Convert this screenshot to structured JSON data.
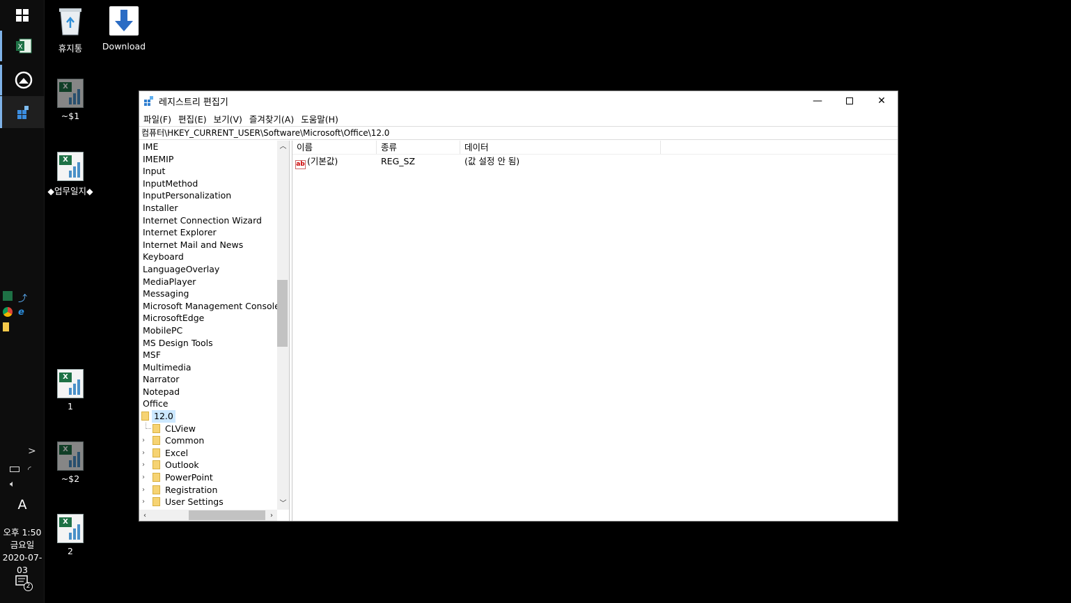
{
  "desktop": {
    "icons": [
      {
        "label": "휴지통"
      },
      {
        "label": "Download"
      },
      {
        "label": "~$1"
      },
      {
        "label": "◆업무일지◆"
      },
      {
        "label": "1"
      },
      {
        "label": "~$2"
      },
      {
        "label": "2"
      }
    ]
  },
  "taskbar": {
    "language": "A",
    "clock": {
      "time": "오후 1:50",
      "day": "금요일",
      "date": "2020-07-03"
    },
    "notification_count": "2",
    "chevron": ">"
  },
  "regedit": {
    "title": "레지스트리 편집기",
    "menus": [
      "파일(F)",
      "편집(E)",
      "보기(V)",
      "즐겨찾기(A)",
      "도움말(H)"
    ],
    "address": "컴퓨터\\HKEY_CURRENT_USER\\Software\\Microsoft\\Office\\12.0",
    "tree": [
      "IME",
      "IMEMIP",
      "Input",
      "InputMethod",
      "InputPersonalization",
      "Installer",
      "Internet Connection Wizard",
      "Internet Explorer",
      "Internet Mail and News",
      "Keyboard",
      "LanguageOverlay",
      "MediaPlayer",
      "Messaging",
      "Microsoft Management Console",
      "MicrosoftEdge",
      "MobilePC",
      "MS Design Tools",
      "MSF",
      "Multimedia",
      "Narrator",
      "Notepad",
      "Office"
    ],
    "selected_key": "12.0",
    "subkeys": [
      "CLView",
      "Common",
      "Excel",
      "Outlook",
      "PowerPoint",
      "Registration",
      "User Settings"
    ],
    "columns": [
      "이름",
      "종류",
      "데이터"
    ],
    "values": [
      {
        "name": "(기본값)",
        "type": "REG_SZ",
        "data": "(값 설정 안 됨)"
      }
    ],
    "value_icon_text": "ab"
  }
}
